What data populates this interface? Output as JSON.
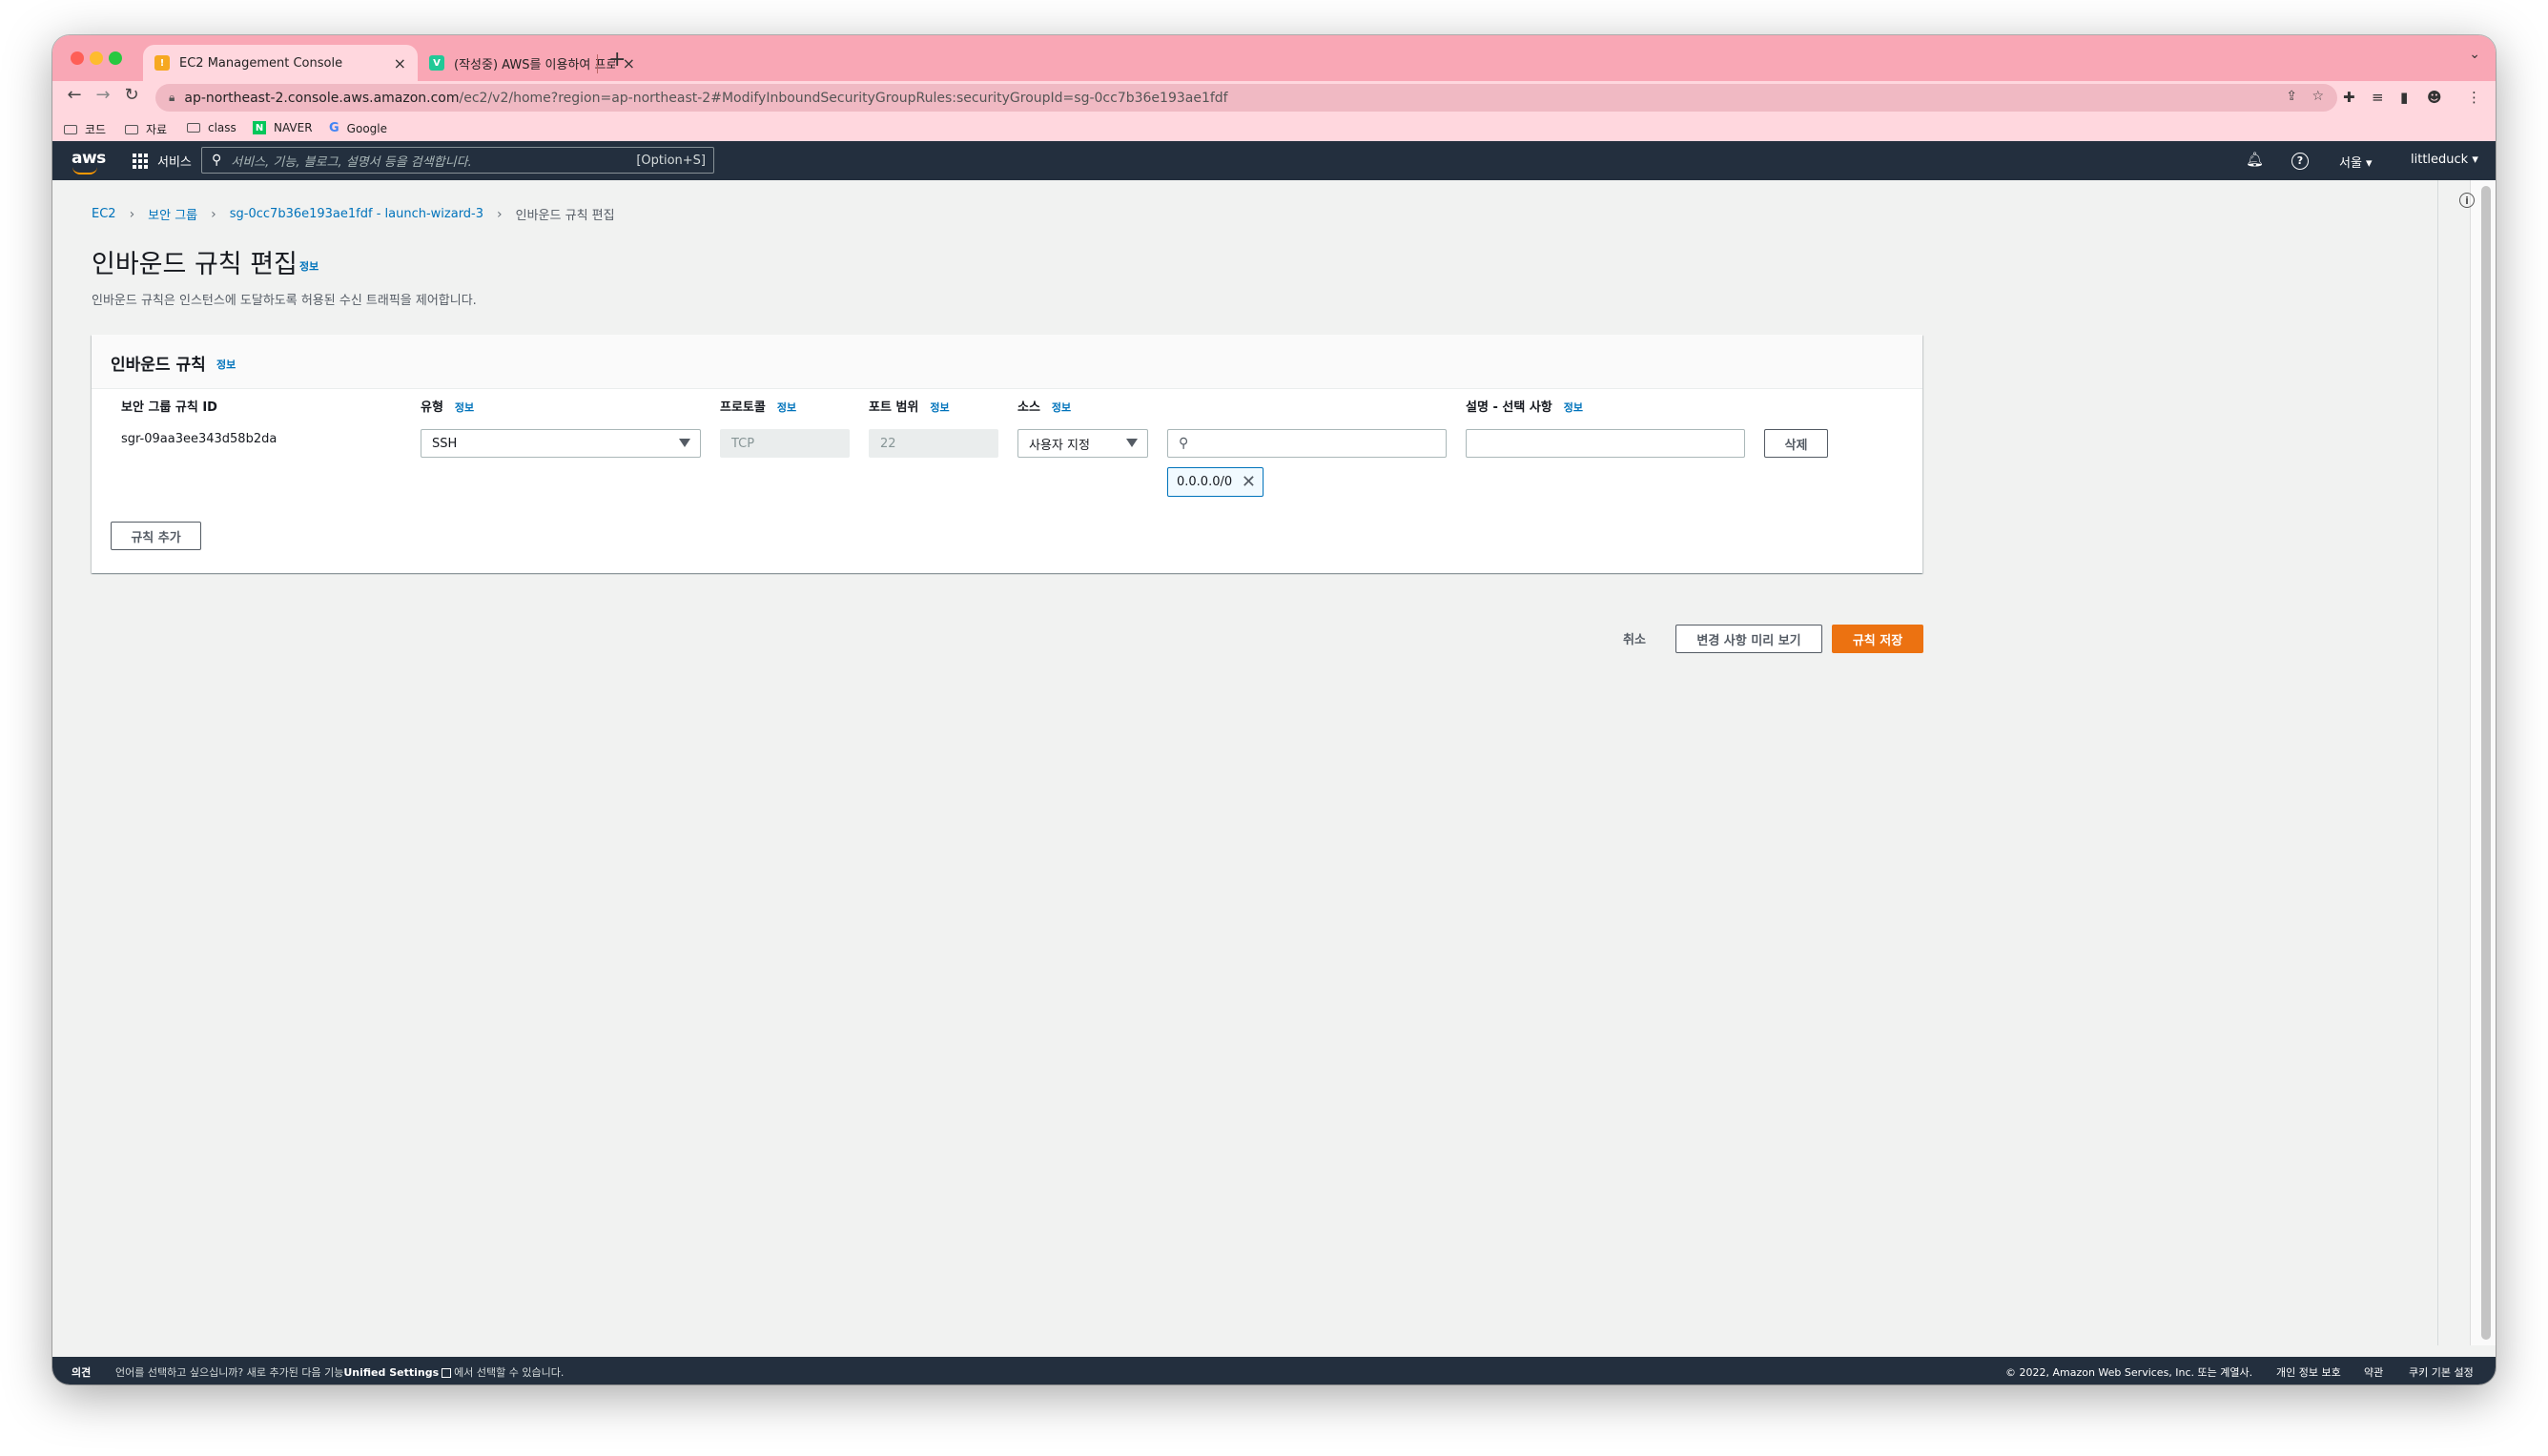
{
  "browser": {
    "tabs": [
      {
        "title": "EC2 Management Console",
        "active": true
      },
      {
        "title": "(작성중) AWS를 이용하여 프로젝트",
        "active": false
      }
    ],
    "new_tab": "+",
    "tab_close": "×",
    "url_host": "ap-northeast-2.console.aws.amazon.com",
    "url_path": "/ec2/v2/home?region=ap-northeast-2#ModifyInboundSecurityGroupRules:securityGroupId=sg-0cc7b36e193ae1fdf",
    "bookmarks": [
      {
        "label": "코드",
        "icon": "folder-icon"
      },
      {
        "label": "자료",
        "icon": "folder-icon"
      },
      {
        "label": "class",
        "icon": "folder-icon"
      },
      {
        "label": "NAVER",
        "icon": "naver-icon"
      },
      {
        "label": "Google",
        "icon": "google-icon"
      }
    ]
  },
  "aws_nav": {
    "logo": "aws",
    "services": "서비스",
    "search_placeholder": "서비스, 기능, 블로그, 설명서 등을 검색합니다.",
    "search_shortcut": "[Option+S]",
    "region": "서울 ▾",
    "user": "littleduck ▾"
  },
  "breadcrumb": {
    "items": [
      "EC2",
      "보안 그룹",
      "sg-0cc7b36e193ae1fdf - launch-wizard-3"
    ],
    "current": "인바운드 규칙 편집"
  },
  "page": {
    "title": "인바운드 규칙 편집",
    "info": "정보",
    "description": "인바운드 규칙은 인스턴스에 도달하도록 허용된 수신 트래픽을 제어합니다."
  },
  "panel": {
    "title": "인바운드 규칙",
    "info": "정보",
    "columns": {
      "rule_id": "보안 그룹 규칙 ID",
      "type": "유형",
      "protocol": "프로토콜",
      "port": "포트 범위",
      "source": "소스",
      "description": "설명 - 선택 사항"
    },
    "rule": {
      "id": "sgr-09aa3ee343d58b2da",
      "type": "SSH",
      "protocol": "TCP",
      "port": "22",
      "source_type": "사용자 지정",
      "source_search": "",
      "source_token": "0.0.0.0/0",
      "description": "",
      "delete_label": "삭제"
    },
    "add_rule_label": "규칙 추가"
  },
  "actions": {
    "cancel": "취소",
    "preview": "변경 사항 미리 보기",
    "save": "규칙 저장"
  },
  "footer": {
    "feedback": "의견",
    "message_pre": "언어를 선택하고 싶으십니까? 새로 추가된 다음 기능",
    "message_bold": "Unified Settings",
    "message_post": "에서 선택할 수 있습니다.",
    "copyright": "© 2022, Amazon Web Services, Inc. 또는 계열사.",
    "privacy": "개인 정보 보호",
    "terms": "약관",
    "cookies": "쿠키 기본 설정"
  },
  "colors": {
    "chrome_frame": "#f9a7b5",
    "aws_nav": "#232f3e",
    "link": "#0073bb",
    "primary_button": "#ec7211"
  }
}
